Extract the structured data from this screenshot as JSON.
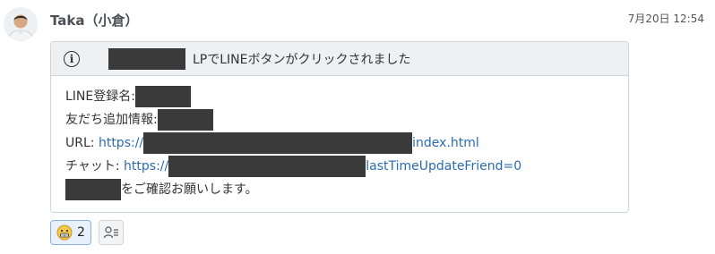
{
  "message": {
    "sender": "Taka（小倉）",
    "timestamp": "7月20日 12:54",
    "card": {
      "header_text": "LPでLINEボタンがクリックされました",
      "line_name_label": "LINE登録名:",
      "friend_info_label": "友だち追加情報:",
      "url_label": "URL:",
      "url_prefix": "https://",
      "url_suffix": "index.html",
      "chat_label": "チャット:",
      "chat_prefix": "https://",
      "chat_suffix": "lastTimeUpdateFriend=0",
      "closing_text": "をご確認お願いします。"
    },
    "reactions": [
      {
        "icon": "grimace-emoji-icon",
        "count": "2"
      }
    ],
    "add_reaction_icon": "user-list-icon"
  }
}
